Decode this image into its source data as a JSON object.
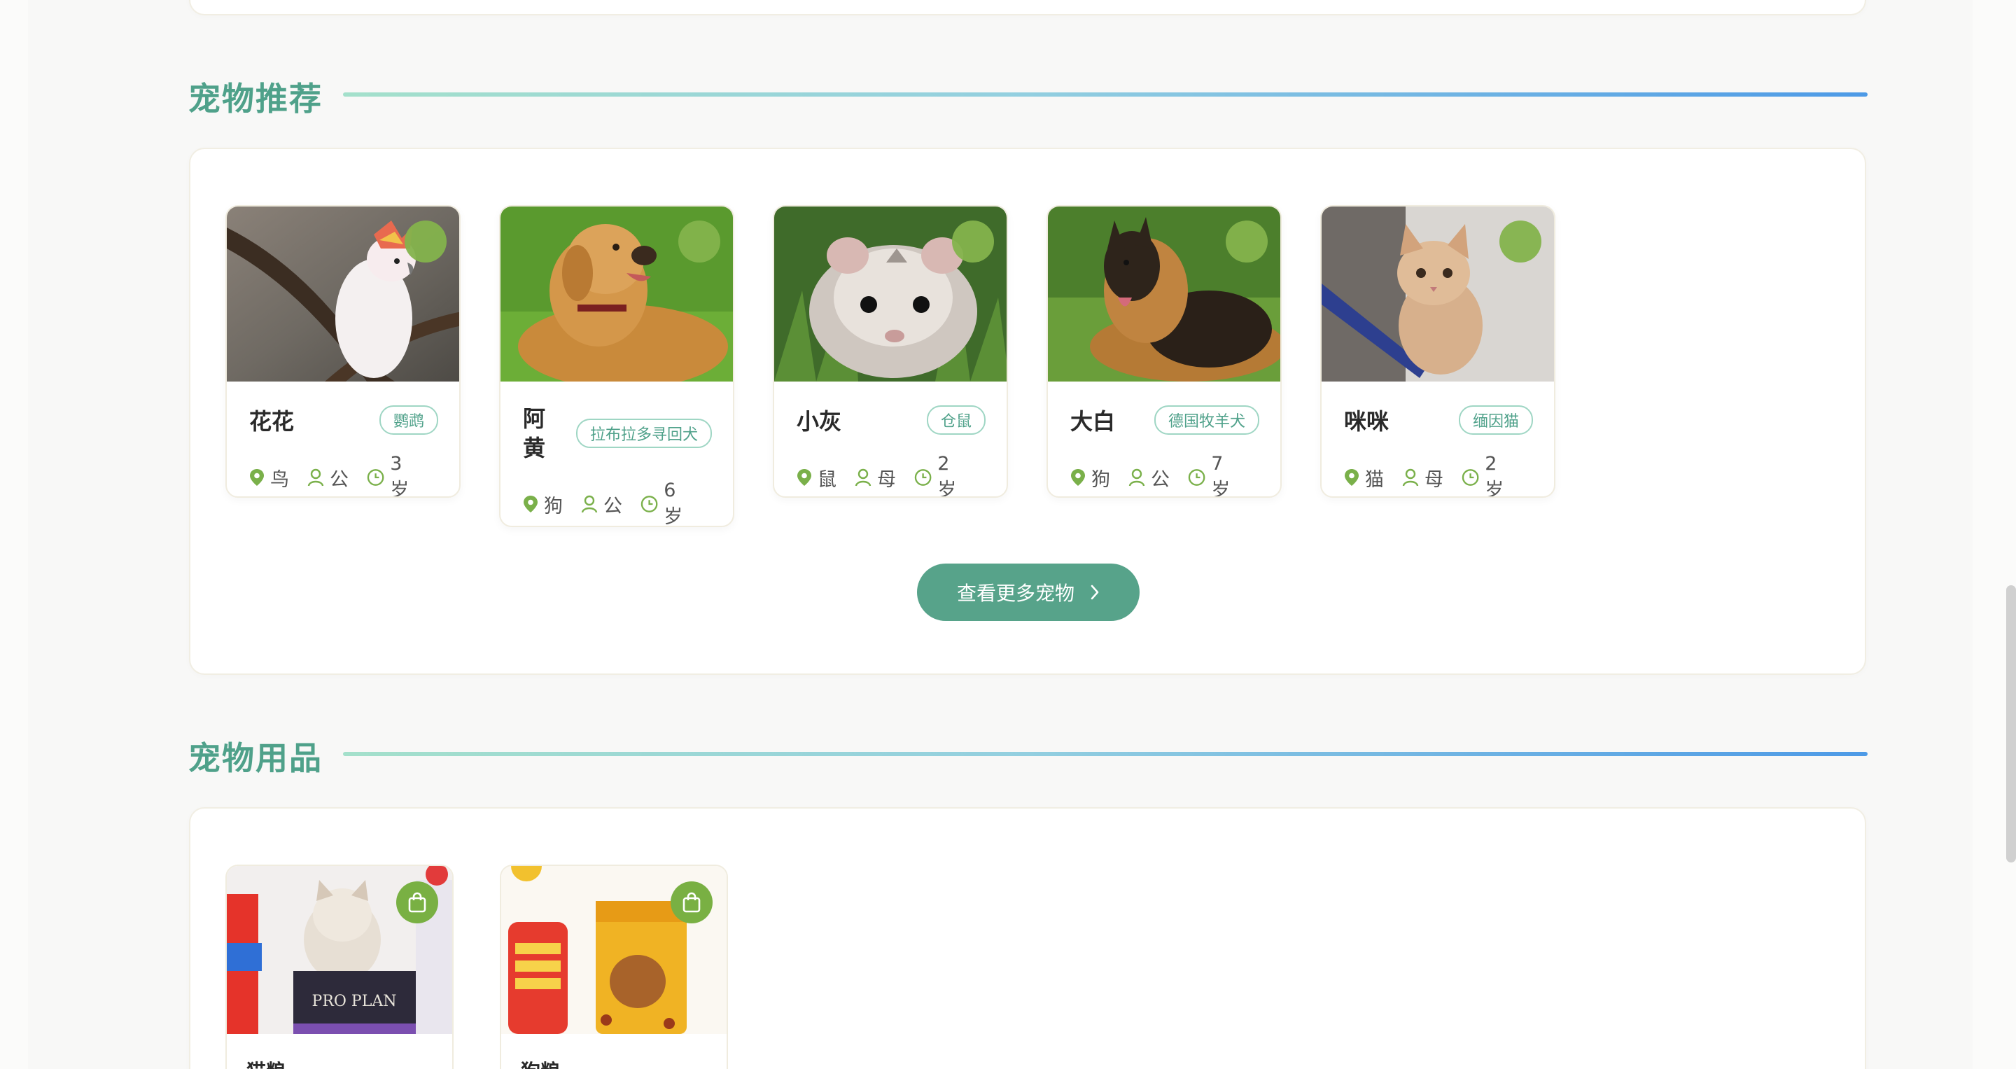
{
  "sections": {
    "pets_title": "宠物推荐",
    "supplies_title": "宠物用品"
  },
  "pets": [
    {
      "name": "花花",
      "tag": "鹦鹉",
      "species": "鸟",
      "gender": "公",
      "age": "3岁"
    },
    {
      "name": "阿黄",
      "tag": "拉布拉多寻回犬",
      "species": "狗",
      "gender": "公",
      "age": "6岁"
    },
    {
      "name": "小灰",
      "tag": "仓鼠",
      "species": "鼠",
      "gender": "母",
      "age": "2岁"
    },
    {
      "name": "大白",
      "tag": "德国牧羊犬",
      "species": "狗",
      "gender": "公",
      "age": "7岁"
    },
    {
      "name": "咪咪",
      "tag": "缅因猫",
      "species": "猫",
      "gender": "母",
      "age": "2岁"
    }
  ],
  "more_pets_button": "查看更多宠物",
  "supplies": [
    {
      "name": "猫粮"
    },
    {
      "name": "狗粮"
    }
  ],
  "colors": {
    "accent": "#4fa18a",
    "button": "#57a38a",
    "favorite_dot": "#84b34c",
    "bag_button": "#79b043"
  },
  "icons": {
    "species": "location-pin-icon",
    "gender": "user-icon",
    "age": "clock-icon",
    "more": "chevron-right-icon",
    "cart": "shopping-bag-icon"
  }
}
